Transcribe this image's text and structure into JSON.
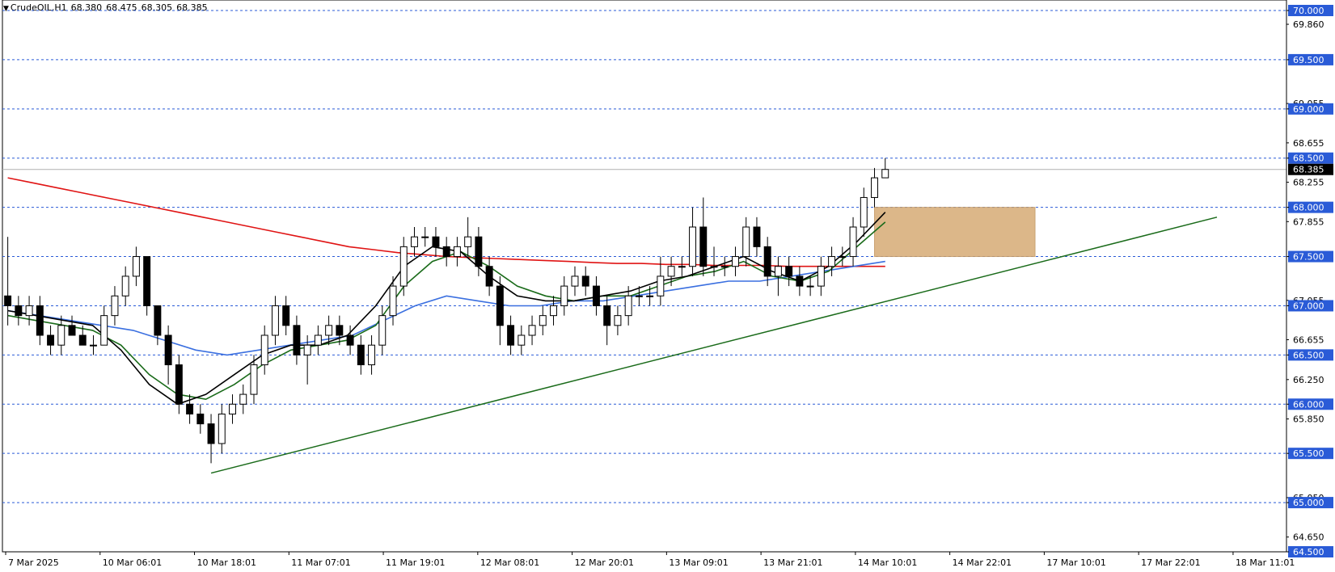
{
  "header": {
    "symbol": "CrudeOIL,H1",
    "open": "68.380",
    "high": "68.475",
    "low": "68.305",
    "close": "68.385"
  },
  "colors": {
    "grid": "#2a5bd7",
    "up_candle": "#000000",
    "down_candle": "#000000",
    "ma_black": "#000000",
    "ma_green": "#1a6b1a",
    "ma_blue": "#3a6fe0",
    "ma_red": "#e01414",
    "trendline": "#1a6b1a",
    "zone": "#d9b07d",
    "price_label_bg": "#000000"
  },
  "chart_data": {
    "type": "candlestick",
    "title": "",
    "y_range": [
      64.5,
      70.0
    ],
    "y_ticks": [
      "70.000",
      "69.860",
      "69.500",
      "69.055",
      "69.000",
      "68.655",
      "68.500",
      "68.255",
      "68.000",
      "67.855",
      "67.500",
      "67.055",
      "67.000",
      "66.655",
      "66.500",
      "66.250",
      "66.000",
      "65.850",
      "65.500",
      "65.050",
      "65.000",
      "64.650",
      "64.500"
    ],
    "highlighted_levels": [
      "70.000",
      "69.500",
      "69.000",
      "68.500",
      "68.000",
      "67.500",
      "67.000",
      "66.500",
      "66.000",
      "65.500",
      "65.000",
      "64.500"
    ],
    "current_price": "68.385",
    "x_labels": [
      "7 Mar 2025",
      "10 Mar 06:01",
      "10 Mar 18:01",
      "11 Mar 07:01",
      "11 Mar 19:01",
      "12 Mar 08:01",
      "12 Mar 20:01",
      "13 Mar 09:01",
      "13 Mar 21:01",
      "14 Mar 10:01",
      "14 Mar 22:01",
      "17 Mar 10:01",
      "17 Mar 22:01",
      "18 Mar 11:01"
    ],
    "candles": [
      [
        67.1,
        67.7,
        66.8,
        67.0
      ],
      [
        67.0,
        67.1,
        66.8,
        66.9
      ],
      [
        66.9,
        67.1,
        66.8,
        67.0
      ],
      [
        67.0,
        67.1,
        66.6,
        66.7
      ],
      [
        66.7,
        66.8,
        66.5,
        66.6
      ],
      [
        66.6,
        66.9,
        66.5,
        66.8
      ],
      [
        66.8,
        66.9,
        66.7,
        66.7
      ],
      [
        66.7,
        66.8,
        66.6,
        66.6
      ],
      [
        66.6,
        66.7,
        66.5,
        66.6
      ],
      [
        66.6,
        67.0,
        66.6,
        66.9
      ],
      [
        66.9,
        67.2,
        66.8,
        67.1
      ],
      [
        67.1,
        67.4,
        67.0,
        67.3
      ],
      [
        67.3,
        67.6,
        67.2,
        67.5
      ],
      [
        67.5,
        67.5,
        66.9,
        67.0
      ],
      [
        67.0,
        67.0,
        66.6,
        66.7
      ],
      [
        66.7,
        66.8,
        66.2,
        66.4
      ],
      [
        66.4,
        66.5,
        65.9,
        66.0
      ],
      [
        66.0,
        66.1,
        65.8,
        65.9
      ],
      [
        65.9,
        66.0,
        65.7,
        65.8
      ],
      [
        65.8,
        65.9,
        65.4,
        65.6
      ],
      [
        65.6,
        66.0,
        65.5,
        65.9
      ],
      [
        65.9,
        66.1,
        65.8,
        66.0
      ],
      [
        66.0,
        66.2,
        65.9,
        66.1
      ],
      [
        66.1,
        66.5,
        66.0,
        66.4
      ],
      [
        66.4,
        66.8,
        66.3,
        66.7
      ],
      [
        66.7,
        67.1,
        66.6,
        67.0
      ],
      [
        67.0,
        67.1,
        66.7,
        66.8
      ],
      [
        66.8,
        66.9,
        66.4,
        66.5
      ],
      [
        66.5,
        66.7,
        66.2,
        66.6
      ],
      [
        66.6,
        66.8,
        66.5,
        66.7
      ],
      [
        66.7,
        66.9,
        66.6,
        66.8
      ],
      [
        66.8,
        66.9,
        66.6,
        66.7
      ],
      [
        66.7,
        66.8,
        66.5,
        66.6
      ],
      [
        66.6,
        66.7,
        66.3,
        66.4
      ],
      [
        66.4,
        66.7,
        66.3,
        66.6
      ],
      [
        66.6,
        67.0,
        66.5,
        66.9
      ],
      [
        66.9,
        67.3,
        66.8,
        67.2
      ],
      [
        67.2,
        67.7,
        67.1,
        67.6
      ],
      [
        67.6,
        67.8,
        67.5,
        67.7
      ],
      [
        67.7,
        67.8,
        67.6,
        67.7
      ],
      [
        67.7,
        67.8,
        67.5,
        67.6
      ],
      [
        67.6,
        67.7,
        67.4,
        67.5
      ],
      [
        67.5,
        67.7,
        67.4,
        67.6
      ],
      [
        67.6,
        67.9,
        67.5,
        67.7
      ],
      [
        67.7,
        67.8,
        67.3,
        67.4
      ],
      [
        67.4,
        67.5,
        67.1,
        67.2
      ],
      [
        67.2,
        67.3,
        66.6,
        66.8
      ],
      [
        66.8,
        66.9,
        66.5,
        66.6
      ],
      [
        66.6,
        66.8,
        66.5,
        66.7
      ],
      [
        66.7,
        66.9,
        66.6,
        66.8
      ],
      [
        66.8,
        67.0,
        66.7,
        66.9
      ],
      [
        66.9,
        67.1,
        66.8,
        67.0
      ],
      [
        67.0,
        67.3,
        66.9,
        67.2
      ],
      [
        67.2,
        67.4,
        67.1,
        67.3
      ],
      [
        67.3,
        67.4,
        67.1,
        67.2
      ],
      [
        67.2,
        67.3,
        66.9,
        67.0
      ],
      [
        67.0,
        67.1,
        66.6,
        66.8
      ],
      [
        66.8,
        67.0,
        66.7,
        66.9
      ],
      [
        66.9,
        67.2,
        66.8,
        67.1
      ],
      [
        67.1,
        67.2,
        67.0,
        67.1
      ],
      [
        67.1,
        67.2,
        67.0,
        67.1
      ],
      [
        67.1,
        67.5,
        67.0,
        67.3
      ],
      [
        67.3,
        67.5,
        67.2,
        67.4
      ],
      [
        67.4,
        67.5,
        67.3,
        67.4
      ],
      [
        67.4,
        68.0,
        67.3,
        67.8
      ],
      [
        67.8,
        68.1,
        67.3,
        67.4
      ],
      [
        67.4,
        67.6,
        67.3,
        67.4
      ],
      [
        67.4,
        67.5,
        67.3,
        67.4
      ],
      [
        67.4,
        67.6,
        67.3,
        67.5
      ],
      [
        67.5,
        67.9,
        67.4,
        67.8
      ],
      [
        67.8,
        67.9,
        67.5,
        67.6
      ],
      [
        67.6,
        67.7,
        67.2,
        67.3
      ],
      [
        67.3,
        67.5,
        67.1,
        67.4
      ],
      [
        67.4,
        67.5,
        67.2,
        67.3
      ],
      [
        67.3,
        67.4,
        67.1,
        67.2
      ],
      [
        67.2,
        67.3,
        67.1,
        67.2
      ],
      [
        67.2,
        67.5,
        67.1,
        67.4
      ],
      [
        67.4,
        67.6,
        67.3,
        67.5
      ],
      [
        67.5,
        67.6,
        67.4,
        67.5
      ],
      [
        67.5,
        67.9,
        67.4,
        67.8
      ],
      [
        67.8,
        68.2,
        67.7,
        68.1
      ],
      [
        68.1,
        68.4,
        68.0,
        68.3
      ],
      [
        68.3,
        68.5,
        68.3,
        68.385
      ]
    ],
    "series": [
      {
        "name": "",
        "color_key": "ma_red",
        "values": [
          68.3,
          68.25,
          68.2,
          68.15,
          68.1,
          68.05,
          68.0,
          67.95,
          67.9,
          67.85,
          67.8,
          67.75,
          67.7,
          67.65,
          67.6,
          67.57,
          67.54,
          67.52,
          67.5,
          67.49,
          67.48,
          67.47,
          67.46,
          67.45,
          67.44,
          67.43,
          67.43,
          67.42,
          67.42,
          67.41,
          67.41,
          67.41,
          67.4,
          67.4,
          67.4,
          67.4,
          67.4
        ]
      },
      {
        "name": "",
        "color_key": "ma_blue",
        "values": [
          66.95,
          66.9,
          66.85,
          66.8,
          66.75,
          66.65,
          66.55,
          66.5,
          66.55,
          66.6,
          66.65,
          66.7,
          66.85,
          67.0,
          67.1,
          67.05,
          67.0,
          67.0,
          67.05,
          67.05,
          67.1,
          67.15,
          67.2,
          67.25,
          67.25,
          67.3,
          67.35,
          67.4,
          67.45
        ]
      },
      {
        "name": "",
        "color_key": "ma_green",
        "values": [
          66.9,
          66.85,
          66.8,
          66.75,
          66.6,
          66.3,
          66.1,
          66.05,
          66.2,
          66.4,
          66.55,
          66.6,
          66.65,
          66.8,
          67.2,
          67.45,
          67.55,
          67.4,
          67.2,
          67.1,
          67.05,
          67.1,
          67.1,
          67.2,
          67.3,
          67.35,
          67.45,
          67.3,
          67.25,
          67.35,
          67.6,
          67.85
        ]
      },
      {
        "name": "",
        "color_key": "ma_black",
        "values": [
          66.95,
          66.9,
          66.85,
          66.8,
          66.55,
          66.2,
          66.0,
          66.1,
          66.3,
          66.5,
          66.6,
          66.6,
          66.7,
          67.0,
          67.4,
          67.6,
          67.55,
          67.3,
          67.1,
          67.05,
          67.05,
          67.1,
          67.15,
          67.25,
          67.3,
          67.4,
          67.5,
          67.35,
          67.25,
          67.4,
          67.65,
          67.95
        ]
      }
    ],
    "trendline": {
      "from": [
        19,
        65.3
      ],
      "to": [
        113,
        67.9
      ]
    },
    "zone": {
      "from": [
        81,
        68.0
      ],
      "to": [
        96,
        67.5
      ]
    }
  }
}
